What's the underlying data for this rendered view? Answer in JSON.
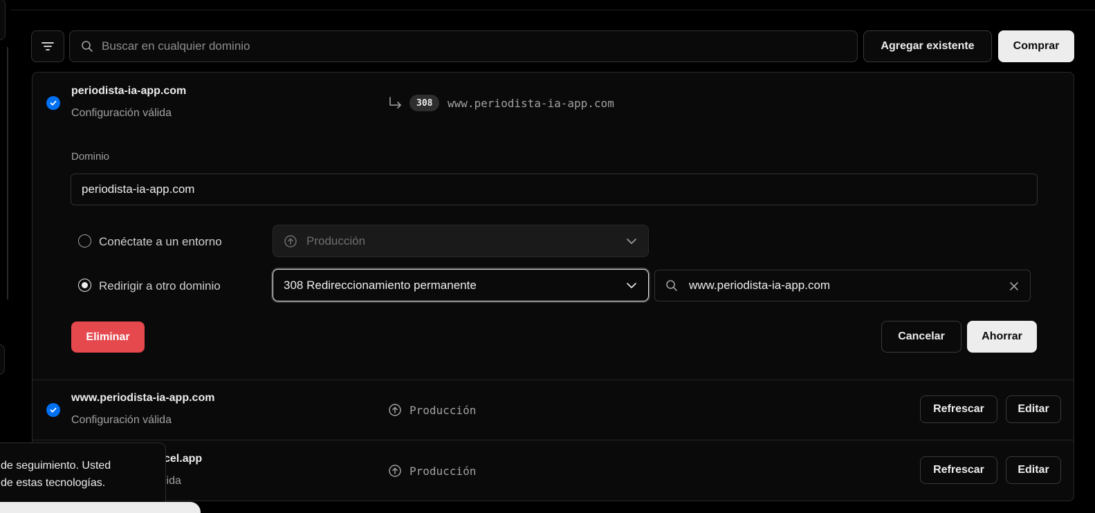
{
  "toolbar": {
    "search_placeholder": "Buscar en cualquier dominio",
    "add_existing_label": "Agregar existente",
    "buy_label": "Comprar"
  },
  "domains": [
    {
      "name": "periodista-ia-app.com",
      "status": "Configuración válida",
      "redirect_code": "308",
      "redirect_target": "www.periodista-ia-app.com",
      "expanded": true
    },
    {
      "name": "www.periodista-ia-app.com",
      "status": "Configuración válida",
      "environment": "Producción",
      "refresh_label": "Refrescar",
      "edit_label": "Editar"
    },
    {
      "name_visible_fragment": "cel.app",
      "status_visible_fragment": "lida",
      "environment": "Producción",
      "refresh_label": "Refrescar",
      "edit_label": "Editar"
    }
  ],
  "editor": {
    "domain_label": "Dominio",
    "domain_value": "periodista-ia-app.com",
    "connect_label": "Conéctate a un entorno",
    "connect_select_value": "Producción",
    "redirect_label": "Redirigir a otro dominio",
    "redirect_select_value": "308 Redireccionamiento permanente",
    "redirect_target_value": "www.periodista-ia-app.com",
    "delete_label": "Eliminar",
    "cancel_label": "Cancelar",
    "save_label": "Ahorrar"
  },
  "cookie_toast": {
    "line1": "de seguimiento. Usted",
    "line2": "de estas tecnologías."
  },
  "colors": {
    "check_blue": "#0070f3",
    "danger_red": "#e5484d",
    "background": "#000000",
    "panel": "#0a0a0a"
  }
}
